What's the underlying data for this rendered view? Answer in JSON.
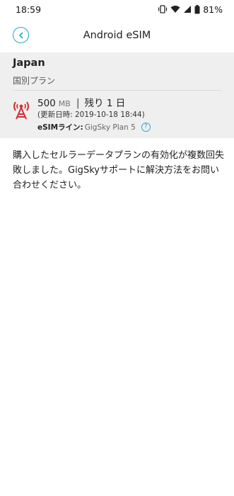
{
  "status_bar": {
    "time": "18:59",
    "battery": "81%",
    "icons": [
      "vibrate-icon",
      "wifi-icon",
      "signal-icon",
      "battery-icon"
    ]
  },
  "app_bar": {
    "back_icon": "chevron-left-icon",
    "title": "Android eSIM"
  },
  "plan": {
    "country": "Japan",
    "type": "国別プラン",
    "icon": "antenna-icon",
    "data_amount": "500",
    "data_unit": "MB",
    "separator": "|",
    "remaining": "残り 1 日",
    "updated": "(更新日時: 2019-10-18 18:44)",
    "esim_label": "eSIMライン:",
    "esim_value": "GigSky Plan 5",
    "help_icon": "?"
  },
  "message": "購入したセルラーデータプランの有効化が複数回失敗しました。GigSkyサポートに解決方法をお問い合わせください。",
  "colors": {
    "accent": "#2aa6c9",
    "antenna": "#d32f2f",
    "panel": "#efefef"
  }
}
